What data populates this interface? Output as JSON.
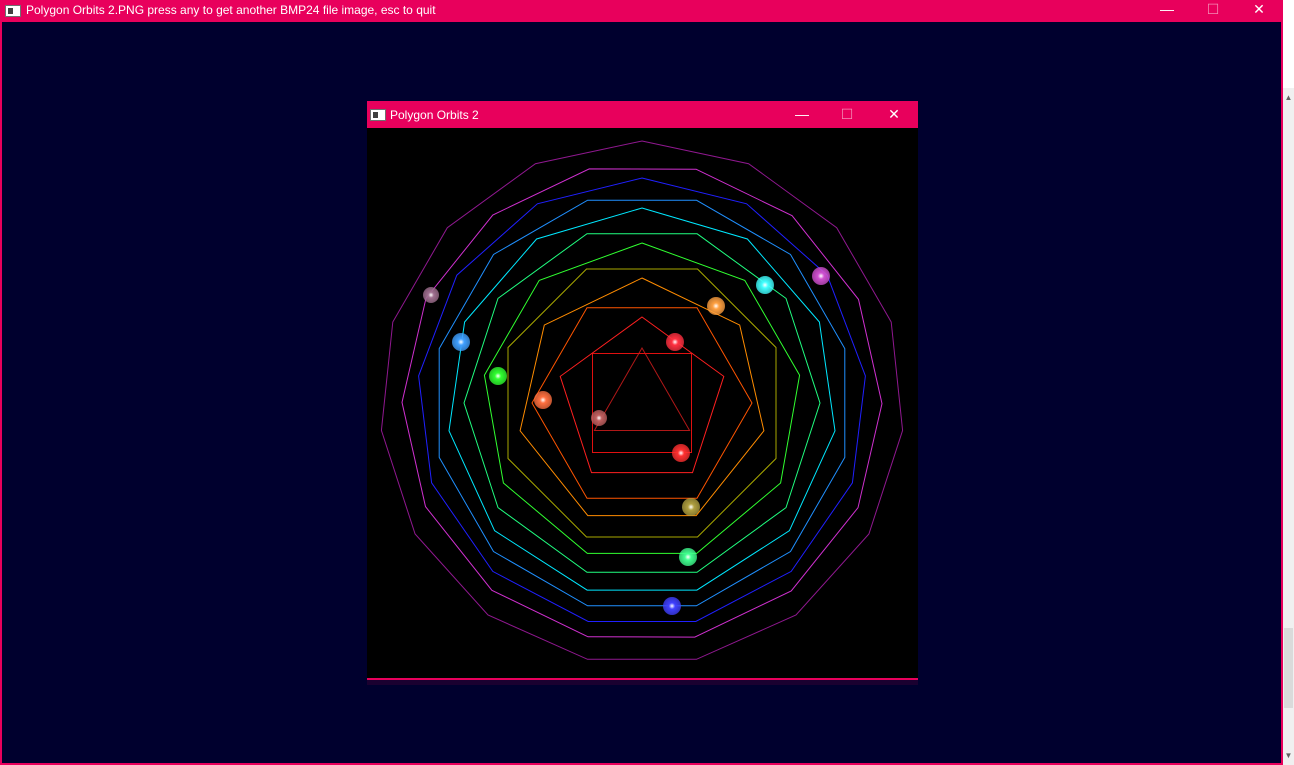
{
  "outer_window": {
    "title": "Polygon Orbits 2.PNG press any to get another BMP24 file image, esc to quit",
    "minimize_glyph": "—",
    "maximize_glyph": "☐",
    "close_glyph": "✕"
  },
  "inner_window": {
    "title": "Polygon Orbits 2",
    "minimize_glyph": "—",
    "maximize_glyph": "☐",
    "close_glyph": "✕"
  },
  "scrollbar": {
    "up_glyph": "▲",
    "down_glyph": "▼"
  },
  "icons": {
    "outer_app_icon": "console-window-icon",
    "inner_app_icon": "console-window-icon"
  },
  "colors": {
    "titlebar": "#e8005c",
    "outer_background": "#00002e",
    "canvas_background": "#000000"
  },
  "orbits": [
    {
      "sides": 3,
      "color": "#b01818",
      "ball_color": "#c06060"
    },
    {
      "sides": 4,
      "color": "#e01010",
      "ball_color": "#ff3030"
    },
    {
      "sides": 5,
      "color": "#ff2020",
      "ball_color": "#ff3040"
    },
    {
      "sides": 6,
      "color": "#ff5500",
      "ball_color": "#ff7040"
    },
    {
      "sides": 7,
      "color": "#ff8c00",
      "ball_color": "#ffa040"
    },
    {
      "sides": 8,
      "color": "#a8a800",
      "ball_color": "#b0a040"
    },
    {
      "sides": 9,
      "color": "#30ff30",
      "ball_color": "#30ff30"
    },
    {
      "sides": 10,
      "color": "#20ff80",
      "ball_color": "#40ff90"
    },
    {
      "sides": 11,
      "color": "#00e8ff",
      "ball_color": "#40ffff"
    },
    {
      "sides": 12,
      "color": "#2090ff",
      "ball_color": "#40a0ff"
    },
    {
      "sides": 13,
      "color": "#2020ff",
      "ball_color": "#4040ff"
    },
    {
      "sides": 14,
      "color": "#d030d0",
      "ball_color": "#d050d0"
    },
    {
      "sides": 15,
      "color": "#901890",
      "ball_color": "#a07090"
    }
  ]
}
